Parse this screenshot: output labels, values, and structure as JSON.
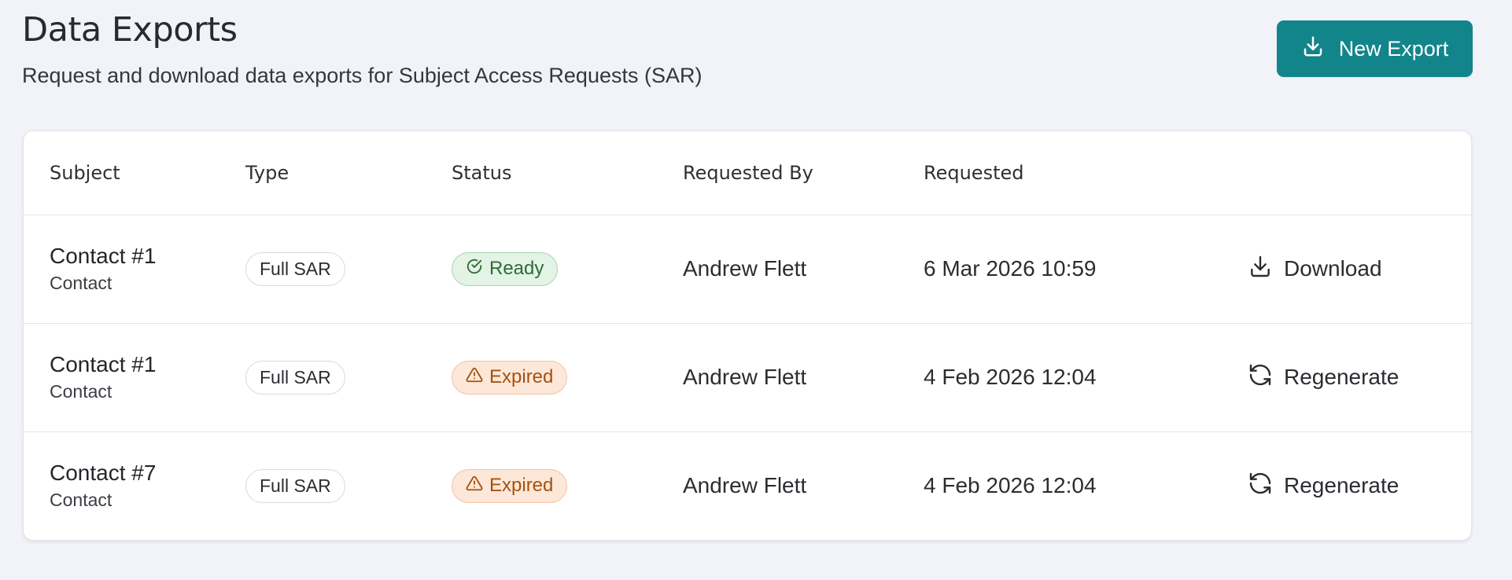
{
  "header": {
    "title": "Data Exports",
    "subtitle": "Request and download data exports for Subject Access Requests (SAR)",
    "new_export_label": "New Export",
    "new_export_icon": "download-icon"
  },
  "colors": {
    "primary": "#11858a",
    "ready_bg": "#e3f3e5",
    "ready_text": "#2f6b37",
    "expired_bg": "#fde7d8",
    "expired_text": "#a4520e"
  },
  "table": {
    "columns": [
      "Subject",
      "Type",
      "Status",
      "Requested By",
      "Requested",
      ""
    ],
    "rows": [
      {
        "subject": "Contact #1",
        "subject_type": "Contact",
        "type": "Full SAR",
        "status": "Ready",
        "status_icon": "check-circle-icon",
        "requested_by": "Andrew Flett",
        "requested": "6 Mar 2026 10:59",
        "action": "Download",
        "action_icon": "download-icon"
      },
      {
        "subject": "Contact #1",
        "subject_type": "Contact",
        "type": "Full SAR",
        "status": "Expired",
        "status_icon": "warning-triangle-icon",
        "requested_by": "Andrew Flett",
        "requested": "4 Feb 2026 12:04",
        "action": "Regenerate",
        "action_icon": "refresh-icon"
      },
      {
        "subject": "Contact #7",
        "subject_type": "Contact",
        "type": "Full SAR",
        "status": "Expired",
        "status_icon": "warning-triangle-icon",
        "requested_by": "Andrew Flett",
        "requested": "4 Feb 2026 12:04",
        "action": "Regenerate",
        "action_icon": "refresh-icon"
      }
    ]
  }
}
